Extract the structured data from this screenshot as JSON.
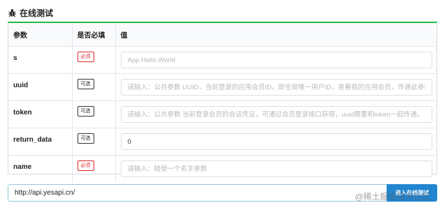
{
  "section": {
    "title": "在线测试",
    "icon": "bug-icon"
  },
  "table": {
    "headers": [
      "参数",
      "是否必填",
      "值"
    ],
    "rows": [
      {
        "name": "s",
        "flag": "必须",
        "flag_type": "required",
        "value": "",
        "placeholder": "App.Hello.World"
      },
      {
        "name": "uuid",
        "flag": "可选",
        "flag_type": "optional",
        "value": "",
        "placeholder": "请输入：公共参数 UUID，当前登录的应用会员ID，即全局唯一用户ID，查看我的应用会员，传递此参数后，"
      },
      {
        "name": "token",
        "flag": "可选",
        "flag_type": "optional",
        "value": "",
        "placeholder": "请输入：公共参数 当前登录会员的会话凭证，可通过会员登录接口获得，uuid需要和token一起传递。"
      },
      {
        "name": "return_data",
        "flag": "可选",
        "flag_type": "optional",
        "value": "0",
        "placeholder": ""
      },
      {
        "name": "name",
        "flag": "必须",
        "flag_type": "required",
        "value": "",
        "placeholder": "请输入：随便一个名字参数"
      }
    ]
  },
  "request": {
    "url": "http://api.yesapi.cn/",
    "submit_label": "进入在线测试"
  },
  "watermark": "@稀土掘金技术社区",
  "colors": {
    "accent_green": "#21ba45",
    "button_blue": "#2185d0",
    "required_red": "#db2828"
  }
}
